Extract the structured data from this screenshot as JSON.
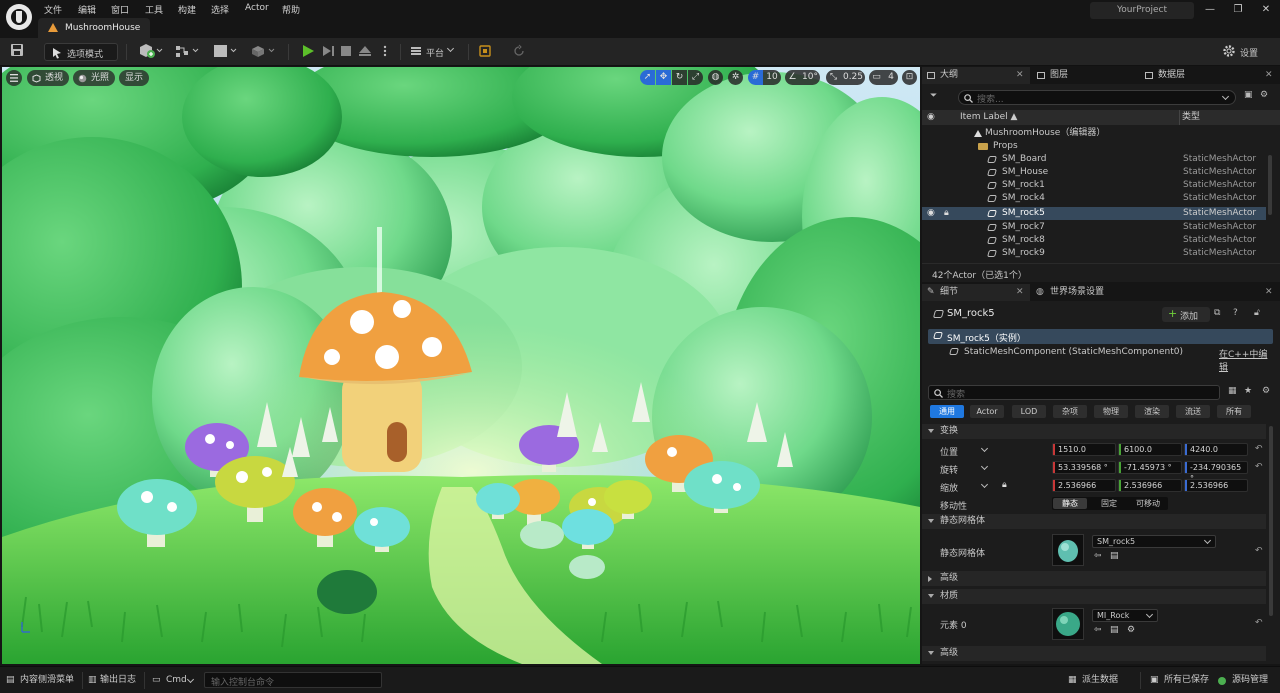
{
  "menu": [
    "文件",
    "编辑",
    "窗口",
    "工具",
    "构建",
    "选择",
    "Actor",
    "帮助"
  ],
  "document_tab": "MushroomHouse",
  "project_name": "YourProject",
  "window_controls": [
    "—",
    "❐",
    "✕"
  ],
  "toolbar": {
    "mode_label": "选项模式",
    "platform_label": "平台",
    "settings_label": "设置"
  },
  "viewport": {
    "perspective_label": "透视",
    "lighting_label": "光照",
    "show_label": "显示",
    "grid_snap_value": "10",
    "rotation_snap_value": "10°",
    "scale_snap_value": "0.25",
    "camera_speed_value": "4"
  },
  "outliner": {
    "tabs": [
      "大纲",
      "图层",
      "数据层"
    ],
    "search_placeholder": "搜索...",
    "col_label": "Item Label ▲",
    "col_type": "类型",
    "level_name": "MushroomHouse（编辑器）",
    "folder_name": "Props",
    "rows": [
      {
        "name": "SM_Board",
        "type": "StaticMeshActor"
      },
      {
        "name": "SM_House",
        "type": "StaticMeshActor"
      },
      {
        "name": "SM_rock1",
        "type": "StaticMeshActor"
      },
      {
        "name": "SM_rock4",
        "type": "StaticMeshActor"
      },
      {
        "name": "SM_rock5",
        "type": "StaticMeshActor"
      },
      {
        "name": "SM_rock7",
        "type": "StaticMeshActor"
      },
      {
        "name": "SM_rock8",
        "type": "StaticMeshActor"
      },
      {
        "name": "SM_rock9",
        "type": "StaticMeshActor"
      }
    ],
    "status": "42个Actor（已选1个）"
  },
  "details": {
    "tabs": [
      "细节",
      "世界场景设置"
    ],
    "actor_name": "SM_rock5",
    "add_label": "添加",
    "instance_label": "SM_rock5（实例）",
    "component_label": "StaticMeshComponent (StaticMeshComponent0)",
    "edit_cpp_label": "在C++中编辑",
    "search_placeholder": "搜索",
    "filters": [
      "通用",
      "Actor",
      "LOD",
      "杂项",
      "物理",
      "渲染",
      "流送",
      "所有"
    ],
    "transform_category": "变换",
    "location_label": "位置",
    "location": [
      "1510.0",
      "6100.0",
      "4240.0"
    ],
    "rotation_label": "旋转",
    "rotation": [
      "53.339568 °",
      "-71.45973 °",
      "-234.790365 °"
    ],
    "scale_label": "缩放",
    "scale": [
      "2.536966",
      "2.536966",
      "2.536966"
    ],
    "mobility_label": "移动性",
    "mobility_options": [
      "静态",
      "固定",
      "可移动"
    ],
    "static_mesh_category": "静态网格体",
    "static_mesh_label": "静态网格体",
    "static_mesh_value": "SM_rock5",
    "advanced_label": "高级",
    "materials_category": "材质",
    "element_label": "元素 0",
    "material_value": "MI_Rock",
    "advanced_label2": "高级"
  },
  "statusbar": {
    "content_drawer": "内容侧滑菜单",
    "output_log": "输出日志",
    "cmd_label": "Cmd",
    "cmd_placeholder": "输入控制台命令",
    "derived_data": "派生数据",
    "all_saved": "所有已保存",
    "source_control": "源码管理"
  },
  "colors": {
    "accent": "#1f78e0",
    "selection": "#36495c",
    "play_green": "#5cbf2a"
  }
}
